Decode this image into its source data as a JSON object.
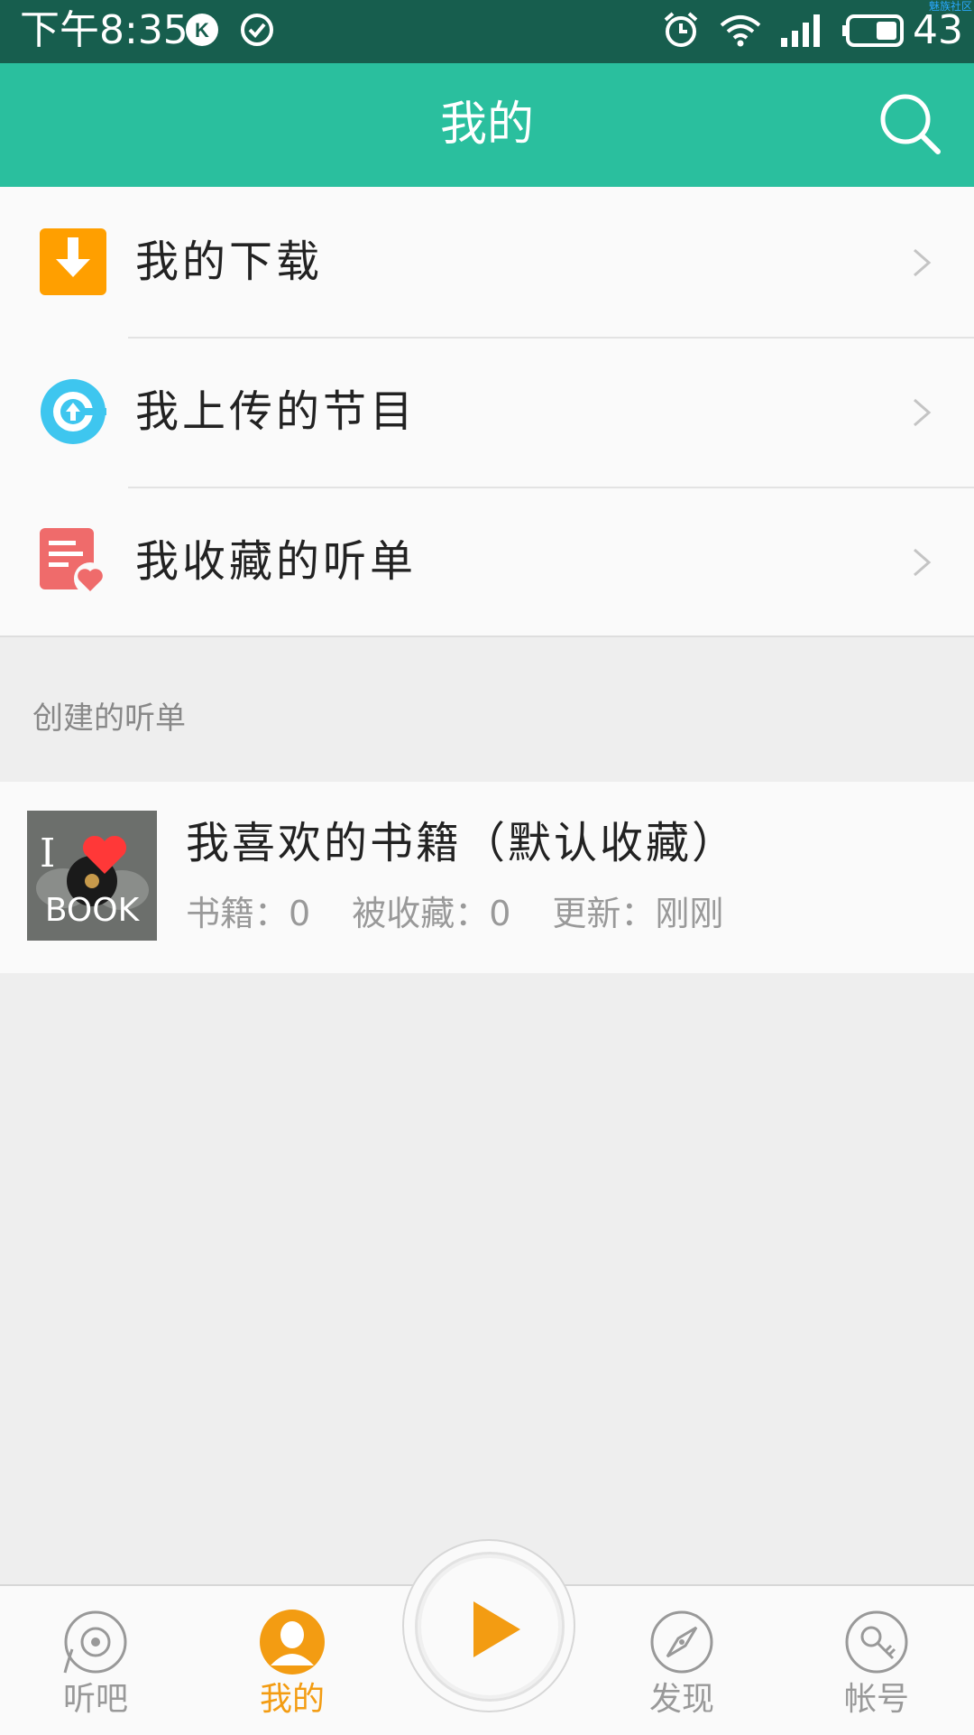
{
  "status_bar": {
    "time": "下午8:35",
    "battery": "43",
    "watermark": "魅族社区"
  },
  "header": {
    "title": "我的"
  },
  "menu": {
    "items": [
      {
        "label": "我的下载",
        "icon": "download-icon",
        "color": "#ff9f00"
      },
      {
        "label": "我上传的节目",
        "icon": "upload-icon",
        "color": "#3ec6ef"
      },
      {
        "label": "我收藏的听单",
        "icon": "favorite-list-icon",
        "color": "#ef6b6b"
      }
    ]
  },
  "section": {
    "title": "创建的听单"
  },
  "playlist": {
    "title": "我喜欢的书籍（默认收藏）",
    "books": "书籍：0",
    "collected": "被收藏：0",
    "updated": "更新：刚刚",
    "cover_text_top": "I",
    "cover_text_bottom": "BOOK"
  },
  "bottom_nav": {
    "tabs": [
      {
        "label": "听吧",
        "icon": "vinyl-icon",
        "active": false
      },
      {
        "label": "我的",
        "icon": "profile-icon",
        "active": true
      },
      {
        "label": "发现",
        "icon": "compass-icon",
        "active": false
      },
      {
        "label": "帐号",
        "icon": "account-icon",
        "active": false
      }
    ],
    "play_icon": "play-icon"
  },
  "colors": {
    "status_bar": "#175e4e",
    "header": "#2abf9e",
    "accent": "#f39c12"
  }
}
